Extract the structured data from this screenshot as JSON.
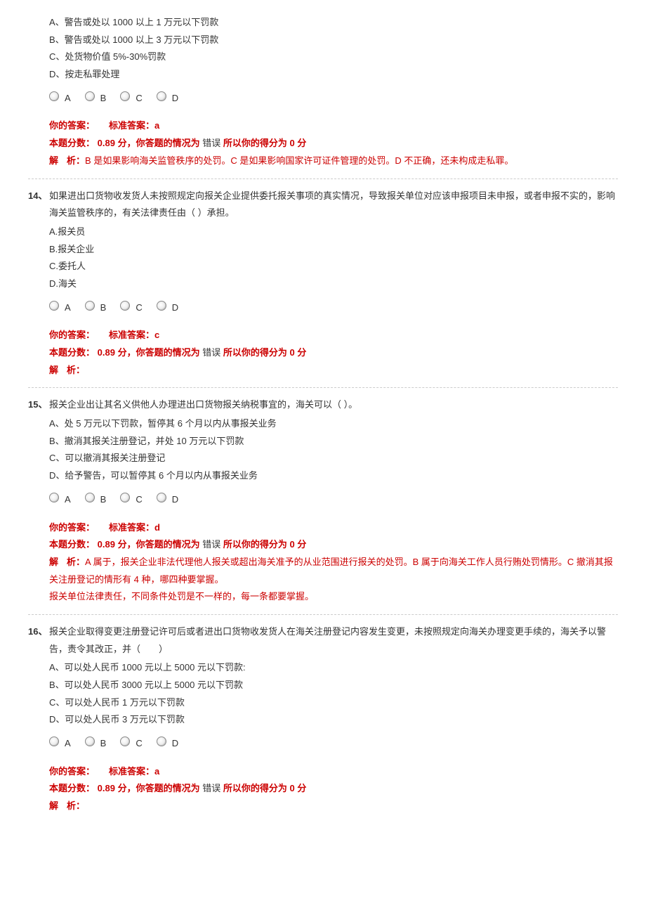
{
  "labels": {
    "your_answer": "你的答案：",
    "std_answer": "标准答案：",
    "score_prefix": "本题分数：",
    "score_unit": "分，你答题的情况为",
    "score_suffix": "所以你的得分为",
    "score_unit2": "分",
    "analysis": "解",
    "analysis2": "析："
  },
  "radio_labels": [
    "A",
    "B",
    "C",
    "D"
  ],
  "questions": [
    {
      "num": "",
      "stem": "",
      "options": [
        "A、警告或处以 1000 以上 1 万元以下罚款",
        "B、警告或处以 1000 以上 3 万元以下罚款",
        "C、处货物价值 5%-30%罚款",
        "D、按走私罪处理"
      ],
      "std": "a",
      "score": "0.89",
      "status": "错误",
      "got": "0",
      "analysis": "B 是如果影响海关监管秩序的处罚。C 是如果影响国家许可证件管理的处罚。D 不正确，还未构成走私罪。"
    },
    {
      "num": "14、",
      "stem": "如果进出口货物收发货人未按照规定向报关企业提供委托报关事项的真实情况，导致报关单位对应该申报项目未申报，或者申报不实的，影响海关监管秩序的，有关法律责任由（ ）承担。",
      "options": [
        "A.报关员",
        "B.报关企业",
        "C.委托人",
        "D.海关"
      ],
      "std": "c",
      "score": "0.89",
      "status": "错误",
      "got": "0",
      "analysis": ""
    },
    {
      "num": "15、",
      "stem": "报关企业出让其名义供他人办理进出口货物报关纳税事宜的，海关可以（ ）。",
      "options": [
        "A、处 5 万元以下罚款，暂停其 6 个月以内从事报关业务",
        "B、撤消其报关注册登记，并处 10 万元以下罚款",
        "C、可以撤消其报关注册登记",
        "D、给予警告，可以暂停其 6 个月以内从事报关业务"
      ],
      "std": "d",
      "score": "0.89",
      "status": "错误",
      "got": "0",
      "analysis": "A 属于，报关企业非法代理他人报关或超出海关准予的从业范围进行报关的处罚。B 属于向海关工作人员行贿处罚情形。C 撤消其报关注册登记的情形有 4 种，哪四种要掌握。\n报关单位法律责任，不同条件处罚是不一样的，每一条都要掌握。"
    },
    {
      "num": "16、",
      "stem": "报关企业取得变更注册登记许可后或者进出口货物收发货人在海关注册登记内容发生变更，未按照规定向海关办理变更手续的，海关予以警告，责令其改正，并（　　）",
      "options": [
        "A、可以处人民币 1000 元以上 5000 元以下罚款:",
        "B、可以处人民币 3000 元以上 5000 元以下罚款",
        "C、可以处人民币 1 万元以下罚款",
        "D、可以处人民币 3 万元以下罚款"
      ],
      "std": "a",
      "score": "0.89",
      "status": "错误",
      "got": "0",
      "analysis": ""
    }
  ]
}
